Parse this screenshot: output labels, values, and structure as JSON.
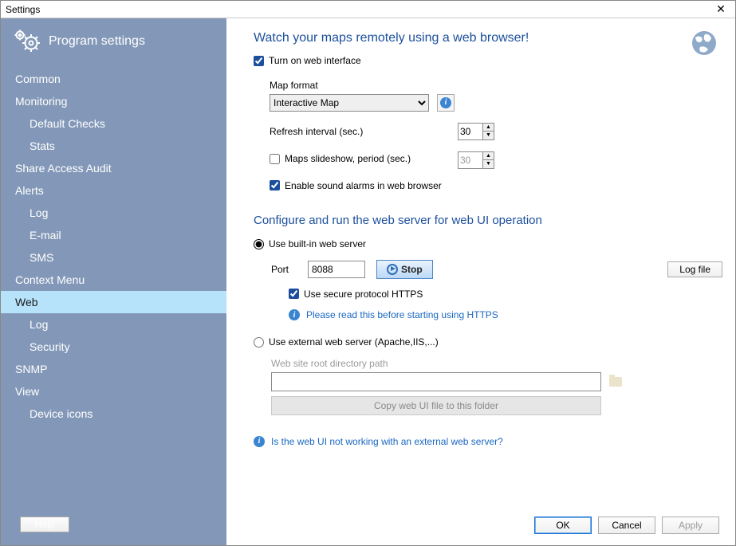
{
  "window": {
    "title": "Settings"
  },
  "sidebar": {
    "heading": "Program settings",
    "help": "Help",
    "items": [
      {
        "label": "Common",
        "level": 0
      },
      {
        "label": "Monitoring",
        "level": 0
      },
      {
        "label": "Default Checks",
        "level": 1
      },
      {
        "label": "Stats",
        "level": 1
      },
      {
        "label": "Share Access Audit",
        "level": 0
      },
      {
        "label": "Alerts",
        "level": 0
      },
      {
        "label": "Log",
        "level": 1
      },
      {
        "label": "E-mail",
        "level": 1
      },
      {
        "label": "SMS",
        "level": 1
      },
      {
        "label": "Context Menu",
        "level": 0
      },
      {
        "label": "Web",
        "level": 0,
        "active": true
      },
      {
        "label": "Log",
        "level": 1
      },
      {
        "label": "Security",
        "level": 1
      },
      {
        "label": "SNMP",
        "level": 0
      },
      {
        "label": "View",
        "level": 0
      },
      {
        "label": "Device icons",
        "level": 1
      }
    ]
  },
  "main": {
    "heading1": "Watch your maps remotely using a web browser!",
    "turn_on": {
      "label": "Turn on web interface",
      "checked": true
    },
    "map_format": {
      "label": "Map format",
      "value": "Interactive Map"
    },
    "refresh": {
      "label": "Refresh interval (sec.)",
      "value": "30"
    },
    "slideshow": {
      "checked": false,
      "label": "Maps slideshow, period (sec.)",
      "value": "30"
    },
    "sound": {
      "checked": true,
      "label": "Enable sound alarms in web browser"
    },
    "heading2": "Configure and run the web server for web UI operation",
    "builtin": {
      "label": "Use built-in web server",
      "selected": true,
      "port_label": "Port",
      "port_value": "8088",
      "stop_label": "Stop",
      "logfile_label": "Log file",
      "https": {
        "checked": true,
        "label": "Use secure protocol HTTPS"
      },
      "https_link": "Please read this before starting using HTTPS"
    },
    "external": {
      "label": "Use external web server (Apache,IIS,...)",
      "selected": false,
      "path_label": "Web site root directory path",
      "path_value": "",
      "copy_label": "Copy web UI file to this folder"
    },
    "troubleshoot_link": "Is the web UI not working with an external web server?"
  },
  "buttons": {
    "ok": "OK",
    "cancel": "Cancel",
    "apply": "Apply"
  }
}
